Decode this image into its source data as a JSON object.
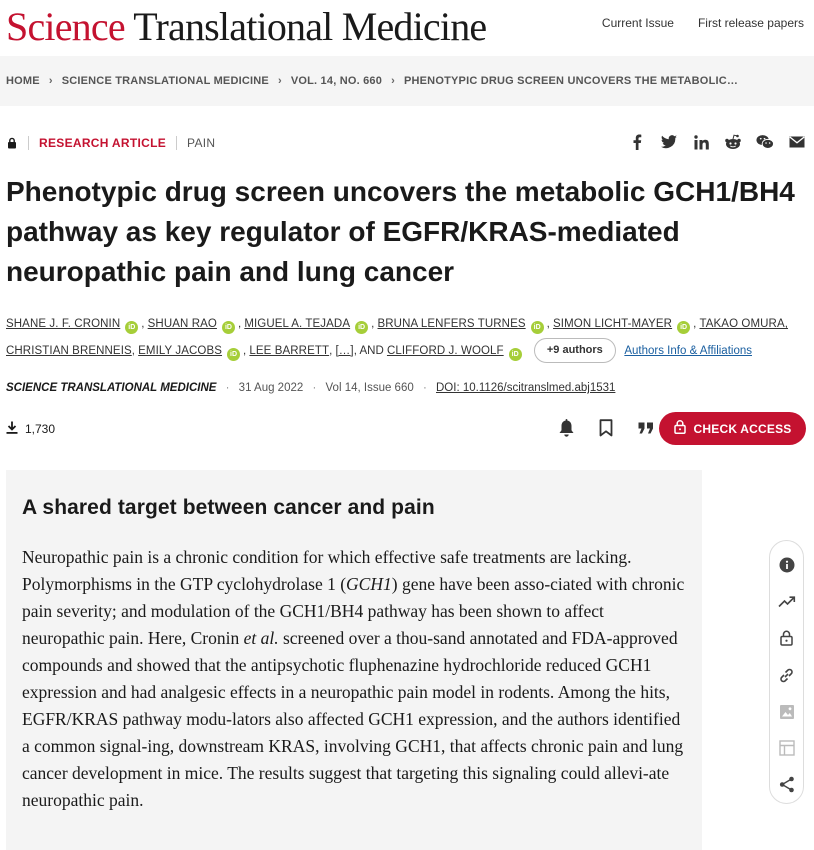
{
  "header": {
    "logo_science": "Science",
    "logo_rest": "Translational Medicine",
    "nav": [
      "Current Issue",
      "First release papers"
    ]
  },
  "breadcrumb": [
    "HOME",
    "SCIENCE TRANSLATIONAL MEDICINE",
    "VOL. 14, NO. 660",
    "PHENOTYPIC DRUG SCREEN UNCOVERS THE METABOLIC…"
  ],
  "article": {
    "type": "RESEARCH ARTICLE",
    "subject": "PAIN",
    "title": "Phenotypic drug screen uncovers the metabolic GCH1/BH4 pathway as key regulator of EGFR/KRAS-mediated neuropathic pain and lung cancer",
    "authors": {
      "a1": "SHANE J. F. CRONIN",
      "a2": "SHUAN RAO",
      "a3": "MIGUEL A. TEJADA",
      "a4": "BRUNA LENFERS TURNES",
      "a5": "SIMON LICHT-MAYER",
      "a6": "TAKAO OMURA,",
      "a7": "CHRISTIAN BRENNEIS",
      "a8": "EMILY JACOBS",
      "a9": "LEE BARRETT",
      "ellipsis": "[…]",
      "and": "AND",
      "a10": "CLIFFORD J. WOOLF",
      "orcid": "iD",
      "more_authors": "+9 authors",
      "affiliations_link": "Authors Info & Affiliations"
    },
    "journal": "SCIENCE TRANSLATIONAL MEDICINE",
    "date": "31 Aug 2022",
    "volume": "Vol 14, Issue 660",
    "doi": "DOI: 10.1126/scitranslmed.abj1531",
    "downloads": "1,730",
    "check_access": "CHECK ACCESS"
  },
  "abstract": {
    "heading": "A shared target between cancer and pain",
    "p1": "Neuropathic pain is a chronic condition for which effective safe treatments are lacking. Polymorphisms in the GTP cyclohydrolase 1 (",
    "gene": "GCH1",
    "p2": ") gene have been asso-ciated with chronic pain severity; and modulation of the GCH1/BH4 pathway has been shown to affect neuropathic pain. Here, Cronin ",
    "etal": "et al.",
    "p3": " screened over a thou-sand annotated and FDA-approved compounds and showed that the antipsychotic fluphenazine hydrochloride reduced GCH1 expression and had analgesic effects in a neuropathic pain model in rodents. Among the hits, EGFR/KRAS pathway modu-lators also affected GCH1 expression, and the authors identified a common signal-ing, downstream KRAS, involving GCH1, that affects chronic pain and lung cancer development in mice. The results suggest that targeting this signaling could allevi-ate neuropathic pain."
  },
  "icons": {
    "share": [
      "facebook-icon",
      "twitter-icon",
      "linkedin-icon",
      "reddit-icon",
      "wechat-icon",
      "email-icon"
    ],
    "actions": [
      "bell-icon",
      "bookmark-icon",
      "quote-icon"
    ],
    "side": [
      "info-icon",
      "trending-icon",
      "lock-icon",
      "link-icon",
      "image-icon",
      "table-icon",
      "share-icon"
    ]
  },
  "colors": {
    "brand_red": "#c41230",
    "orcid_green": "#a6ce39",
    "link_blue": "#1a5fa0"
  }
}
